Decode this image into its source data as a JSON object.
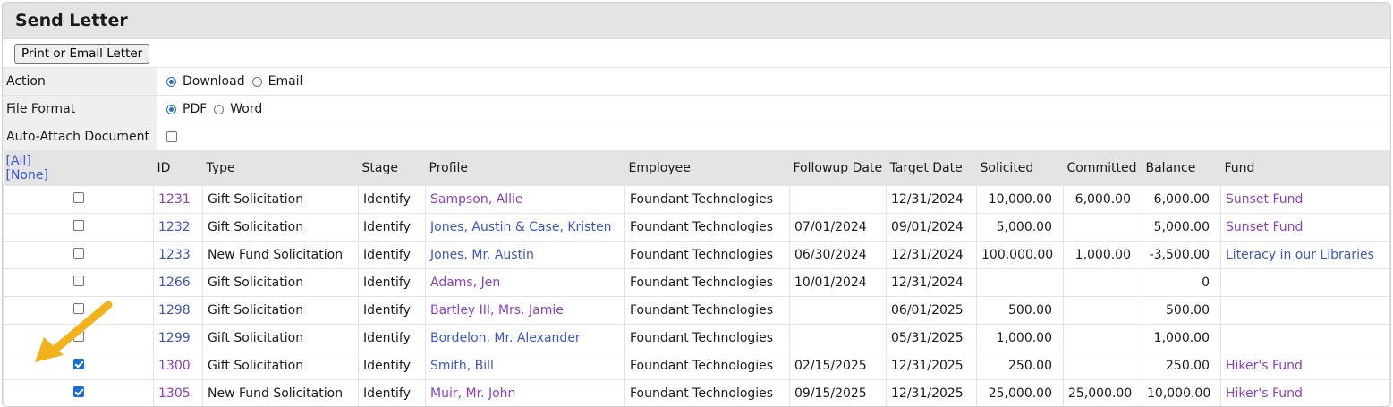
{
  "title": "Send Letter",
  "button_label": "Print or Email Letter",
  "options": {
    "action": {
      "label": "Action",
      "choices": [
        "Download",
        "Email"
      ],
      "selected": "Download"
    },
    "file_format": {
      "label": "File Format",
      "choices": [
        "PDF",
        "Word"
      ],
      "selected": "PDF"
    },
    "auto_attach": {
      "label": "Auto-Attach Document",
      "checked": false
    }
  },
  "select_links": {
    "all": "[All]",
    "none": "[None]"
  },
  "columns": [
    "ID",
    "Type",
    "Stage",
    "Profile",
    "Employee",
    "Followup Date",
    "Target Date",
    "Solicited",
    "Committed",
    "Balance",
    "Fund"
  ],
  "rows": [
    {
      "checked": false,
      "id": "1231",
      "type": "Gift Solicitation",
      "stage": "Identify",
      "profile": "Sampson, Allie",
      "employee": "Foundant Technologies",
      "followup": "",
      "target": "12/31/2024",
      "solicited": "10,000.00",
      "committed": "6,000.00",
      "balance": "6,000.00",
      "fund": "Sunset Fund"
    },
    {
      "checked": false,
      "id": "1232",
      "type": "Gift Solicitation",
      "stage": "Identify",
      "profile": "Jones, Austin & Case, Kristen",
      "employee": "Foundant Technologies",
      "followup": "07/01/2024",
      "target": "09/01/2024",
      "solicited": "5,000.00",
      "committed": "",
      "balance": "5,000.00",
      "fund": "Sunset Fund"
    },
    {
      "checked": false,
      "id": "1233",
      "type": "New Fund Solicitation",
      "stage": "Identify",
      "profile": "Jones, Mr. Austin",
      "employee": "Foundant Technologies",
      "followup": "06/30/2024",
      "target": "12/31/2024",
      "solicited": "100,000.00",
      "committed": "1,000.00",
      "balance": "-3,500.00",
      "fund": "Literacy in our Libraries"
    },
    {
      "checked": false,
      "id": "1266",
      "type": "Gift Solicitation",
      "stage": "Identify",
      "profile": "Adams, Jen",
      "employee": "Foundant Technologies",
      "followup": "10/01/2024",
      "target": "12/31/2024",
      "solicited": "",
      "committed": "",
      "balance": "0",
      "fund": ""
    },
    {
      "checked": false,
      "id": "1298",
      "type": "Gift Solicitation",
      "stage": "Identify",
      "profile": "Bartley III, Mrs. Jamie",
      "employee": "Foundant Technologies",
      "followup": "",
      "target": "06/01/2025",
      "solicited": "500.00",
      "committed": "",
      "balance": "500.00",
      "fund": ""
    },
    {
      "checked": false,
      "id": "1299",
      "type": "Gift Solicitation",
      "stage": "Identify",
      "profile": "Bordelon, Mr. Alexander",
      "employee": "Foundant Technologies",
      "followup": "",
      "target": "05/31/2025",
      "solicited": "1,000.00",
      "committed": "",
      "balance": "1,000.00",
      "fund": ""
    },
    {
      "checked": true,
      "id": "1300",
      "type": "Gift Solicitation",
      "stage": "Identify",
      "profile": "Smith, Bill",
      "employee": "Foundant Technologies",
      "followup": "02/15/2025",
      "target": "12/31/2025",
      "solicited": "250.00",
      "committed": "",
      "balance": "250.00",
      "fund": "Hiker's Fund"
    },
    {
      "checked": true,
      "id": "1305",
      "type": "New Fund Solicitation",
      "stage": "Identify",
      "profile": "Muir, Mr. John",
      "employee": "Foundant Technologies",
      "followup": "09/15/2025",
      "target": "12/31/2025",
      "solicited": "25,000.00",
      "committed": "25,000.00",
      "balance": "10,000.00",
      "fund": "Hiker's Fund"
    }
  ],
  "link_colors": {
    "visited": "#8e3ec4",
    "unvisited": "#3a55cc"
  },
  "row_link_styles": [
    {
      "id": "purple",
      "profile": "purple",
      "fund": "purple"
    },
    {
      "id": "blue",
      "profile": "blue",
      "fund": "purple"
    },
    {
      "id": "blue",
      "profile": "blue",
      "fund": "blue"
    },
    {
      "id": "blue",
      "profile": "purple",
      "fund": ""
    },
    {
      "id": "blue",
      "profile": "purple",
      "fund": ""
    },
    {
      "id": "blue",
      "profile": "blue",
      "fund": ""
    },
    {
      "id": "purple",
      "profile": "blue",
      "fund": "purple"
    },
    {
      "id": "purple",
      "profile": "purple",
      "fund": "purple"
    }
  ],
  "annotation": {
    "icon": "arrow-pointer-icon",
    "color": "#f2b21b"
  }
}
